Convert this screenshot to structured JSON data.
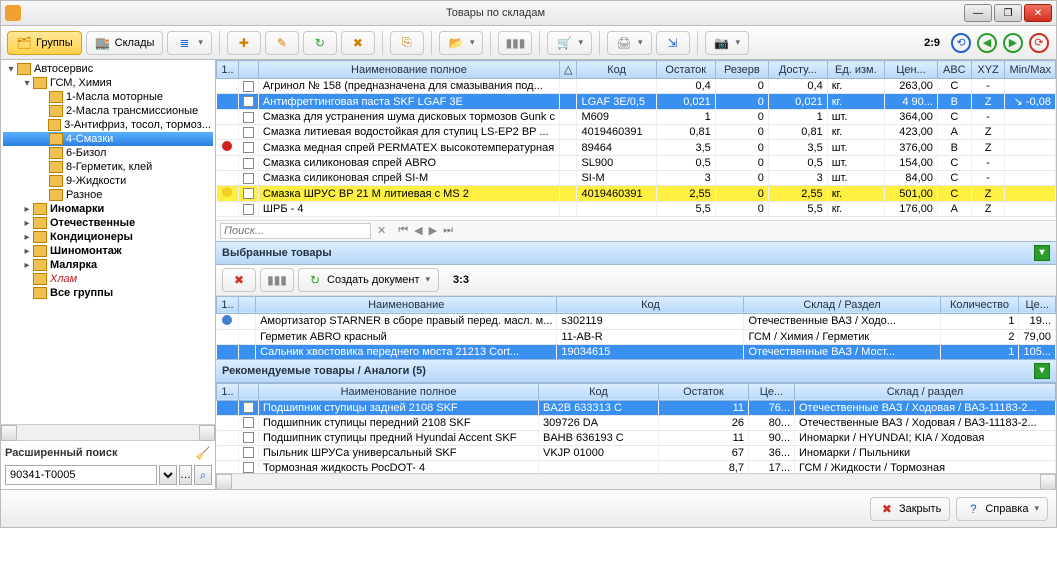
{
  "window": {
    "title": "Товары по складам"
  },
  "toolbar": {
    "groups": "Группы",
    "warehouses": "Склады",
    "counter": "2:9"
  },
  "tree": {
    "nodes": [
      {
        "lvl": 0,
        "exp": true,
        "label": "Автосервис"
      },
      {
        "lvl": 1,
        "exp": true,
        "label": "ГСМ, Химия"
      },
      {
        "lvl": 2,
        "label": "1-Масла моторные"
      },
      {
        "lvl": 2,
        "label": "2-Масла трансмиссионые"
      },
      {
        "lvl": 2,
        "label": "3-Антифриз, тосол, тормоз..."
      },
      {
        "lvl": 2,
        "label": "4-Смазки",
        "sel": true
      },
      {
        "lvl": 2,
        "label": "6-Бизол"
      },
      {
        "lvl": 2,
        "label": "8-Герметик, клей"
      },
      {
        "lvl": 2,
        "label": "9-Жидкости"
      },
      {
        "lvl": 2,
        "label": "Разное"
      },
      {
        "lvl": 1,
        "exp": false,
        "label": "Иномарки",
        "bold": true
      },
      {
        "lvl": 1,
        "exp": false,
        "label": "Отечественные",
        "bold": true
      },
      {
        "lvl": 1,
        "exp": false,
        "label": "Кондиционеры",
        "bold": true
      },
      {
        "lvl": 1,
        "exp": false,
        "label": "Шиномонтаж",
        "bold": true
      },
      {
        "lvl": 1,
        "exp": false,
        "label": "Малярка",
        "bold": true
      },
      {
        "lvl": 1,
        "label": "Хлам",
        "red": true
      },
      {
        "lvl": 1,
        "label": "Все группы",
        "bold": true
      }
    ]
  },
  "search": {
    "label": "Расширенный поиск",
    "value": "90341-T0005"
  },
  "grid1": {
    "cols": [
      "1..",
      "",
      "Наименование полное",
      "△",
      "Код",
      "Остаток",
      "Резерв",
      "Досту...",
      "Ед. изм.",
      "Цен...",
      "ABC",
      "XYZ",
      "Min/Max"
    ],
    "rows": [
      {
        "ico": "",
        "name": "Агринол № 158  (предназначена для смазывания под...",
        "code": "",
        "ost": "0,4",
        "rez": "0",
        "dos": "0,4",
        "ed": "кг.",
        "cen": "263,00",
        "abc": "C",
        "xyz": "-",
        "mm": ""
      },
      {
        "hl": "blue",
        "name": "Антифреттинговая паста SKF LGAF 3E",
        "code": "LGAF 3E/0,5",
        "ost": "0,021",
        "rez": "0",
        "dos": "0,021",
        "ed": "кг.",
        "cen": "4 90...",
        "abc": "B",
        "xyz": "Z",
        "mm": "↘ -0,08"
      },
      {
        "name": "Смазка для устранения шума дисковых тормозов Gunk с",
        "code": "M609",
        "ost": "1",
        "rez": "0",
        "dos": "1",
        "ed": "шт.",
        "cen": "364,00",
        "abc": "C",
        "xyz": "-",
        "mm": ""
      },
      {
        "name": "Смазка литиевая водостойкая для ступиц  LS-EP2  BP ...",
        "code": "4019460391",
        "ost": "0,81",
        "rez": "0",
        "dos": "0,81",
        "ed": "кг.",
        "cen": "423,00",
        "abc": "A",
        "xyz": "Z",
        "mm": ""
      },
      {
        "ico": "red",
        "name": "Смазка медная спрей PERMATEX высокотемпературная",
        "code": "89464",
        "ost": "3,5",
        "rez": "0",
        "dos": "3,5",
        "ed": "шт.",
        "cen": "376,00",
        "abc": "B",
        "xyz": "Z",
        "mm": ""
      },
      {
        "name": "Смазка силиконовая спрей  ABRO",
        "code": "SL900",
        "ost": "0,5",
        "rez": "0",
        "dos": "0,5",
        "ed": "шт.",
        "cen": "154,00",
        "abc": "C",
        "xyz": "-",
        "mm": ""
      },
      {
        "name": "Смазка силиконовая спрей SI-M",
        "code": "SI-M",
        "ost": "3",
        "rez": "0",
        "dos": "3",
        "ed": "шт.",
        "cen": "84,00",
        "abc": "C",
        "xyz": "-",
        "mm": ""
      },
      {
        "hl": "yellow",
        "ico": "yellow",
        "name": "Смазка ШРУС  BP 21 M литиевая с MS 2",
        "code": "4019460391",
        "ost": "2,55",
        "rez": "0",
        "dos": "2,55",
        "ed": "кг.",
        "cen": "501,00",
        "abc": "C",
        "xyz": "Z",
        "mm": ""
      },
      {
        "name": "ШРБ - 4",
        "code": "",
        "ost": "5,5",
        "rez": "0",
        "dos": "5,5",
        "ed": "кг.",
        "cen": "176,00",
        "abc": "A",
        "xyz": "Z",
        "mm": ""
      }
    ],
    "filter_placeholder": "Поиск..."
  },
  "sel_section": {
    "title": "Выбранные товары",
    "counter": "3:3",
    "create_doc": "Создать документ",
    "cols": [
      "1..",
      "",
      "Наименование",
      "Код",
      "Склад / Раздел",
      "Количество",
      "Це..."
    ],
    "rows": [
      {
        "ico": "blue",
        "name": "Амортизатор STARNER в сборе правый перед. масл. м...",
        "code": "s302119",
        "wh": "Отечественные ВАЗ / Ходо...",
        "qty": "1",
        "pr": "19..."
      },
      {
        "name": "Герметик ABRO красный",
        "code": "11-AB-R",
        "wh": "ГСМ / Химия / Герметик",
        "qty": "2",
        "pr": "79,00"
      },
      {
        "hl": "blue",
        "name": "Сальник хвостовика переднего моста 21213 Cort...",
        "code": "19034615",
        "wh": "Отечественные ВАЗ / Мост...",
        "qty": "1",
        "pr": "105..."
      }
    ]
  },
  "rec_section": {
    "title": "Рекомендуемые товары / Аналоги (5)",
    "cols": [
      "1..",
      "",
      "Наименование полное",
      "Код",
      "Остаток",
      "Це...",
      "Склад / раздел"
    ],
    "rows": [
      {
        "name": "Подшипник ступицы задней  2108 SKF",
        "code": "BA2B 633313 C",
        "ost": "11",
        "pr": "76...",
        "wh": "Отечественные ВАЗ / Ходовая / ВАЗ-11183-2..."
      },
      {
        "name": "Подшипник ступицы передний 2108 SKF",
        "code": "309726 DA",
        "ost": "26",
        "pr": "80...",
        "wh": "Отечественные ВАЗ / Ходовая / ВАЗ-11183-2..."
      },
      {
        "name": "Подшипник ступицы предний  Hyundai Accent  SKF",
        "code": "BAHB 636193 C",
        "ost": "11",
        "pr": "90...",
        "wh": "Иномарки / HYUNDAI; KIA / Ходовая"
      },
      {
        "name": "Пыльник ШРУСа универсальный SKF",
        "code": "VKJP 01000",
        "ost": "67",
        "pr": "36...",
        "wh": "Иномарки / Пыльники"
      },
      {
        "name": "Тормозная жидкость РосDOT- 4",
        "code": "",
        "ost": "8,7",
        "pr": "17...",
        "wh": "ГСМ / Жидкости / Тормозная"
      }
    ]
  },
  "footer": {
    "close": "Закрыть",
    "help": "Справка"
  }
}
